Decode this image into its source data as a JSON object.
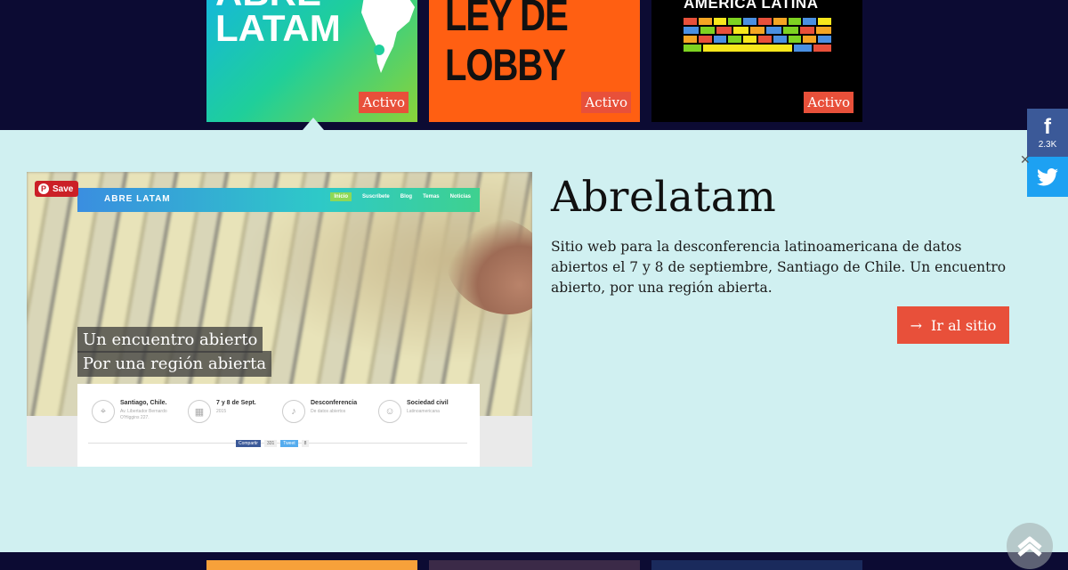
{
  "tiles_top": [
    {
      "title": "ABRE\nLATAM",
      "badge": "Activo"
    },
    {
      "title": "LEY DE LOBBY",
      "badge": "Activo"
    },
    {
      "title": "AMÉRICA LATINA",
      "badge": "Activo"
    }
  ],
  "project": {
    "title": "Abrelatam",
    "description": "Sitio web para la desconferencia latinoamericana de datos abiertos el 7 y 8 de septiembre, Santiago de Chile. Un encuentro abierto, por una región abierta.",
    "cta_arrow": "→",
    "cta_label": "Ir al sitio"
  },
  "screenshot": {
    "save_label": "Save",
    "pin_icon": "P",
    "logo": "ABRE LATAM",
    "menu": [
      "Inicio",
      "Suscríbete",
      "Blog",
      "Temas",
      "Noticias"
    ],
    "hero_line1": "Un encuentro abierto",
    "hero_line2": "Por una región abierta",
    "features": [
      {
        "icon": "location-icon",
        "glyph": "⌖",
        "title": "Santiago, Chile.",
        "sub": "Av. Libertador Bernardo O'Higgins 227."
      },
      {
        "icon": "calendar-icon",
        "glyph": "▦",
        "title": "7 y 8 de Sept.",
        "sub": "2015"
      },
      {
        "icon": "microphone-icon",
        "glyph": "♪",
        "title": "Desconferencia",
        "sub": "De datos abiertos"
      },
      {
        "icon": "people-icon",
        "glyph": "☺",
        "title": "Sociedad civil",
        "sub": "Latinoamericana"
      }
    ],
    "share_fb": "Compartir",
    "share_fb_count": "331",
    "share_tw": "Tweet",
    "share_tw_count": "8"
  },
  "social": {
    "facebook_glyph": "f",
    "facebook_count": "2.3K",
    "close_glyph": "✕"
  },
  "colors": {
    "background": "#0c0b33",
    "panel": "#d0f0f1",
    "accent": "#e8503a",
    "facebook": "#3b5998",
    "twitter": "#1da1f2"
  }
}
